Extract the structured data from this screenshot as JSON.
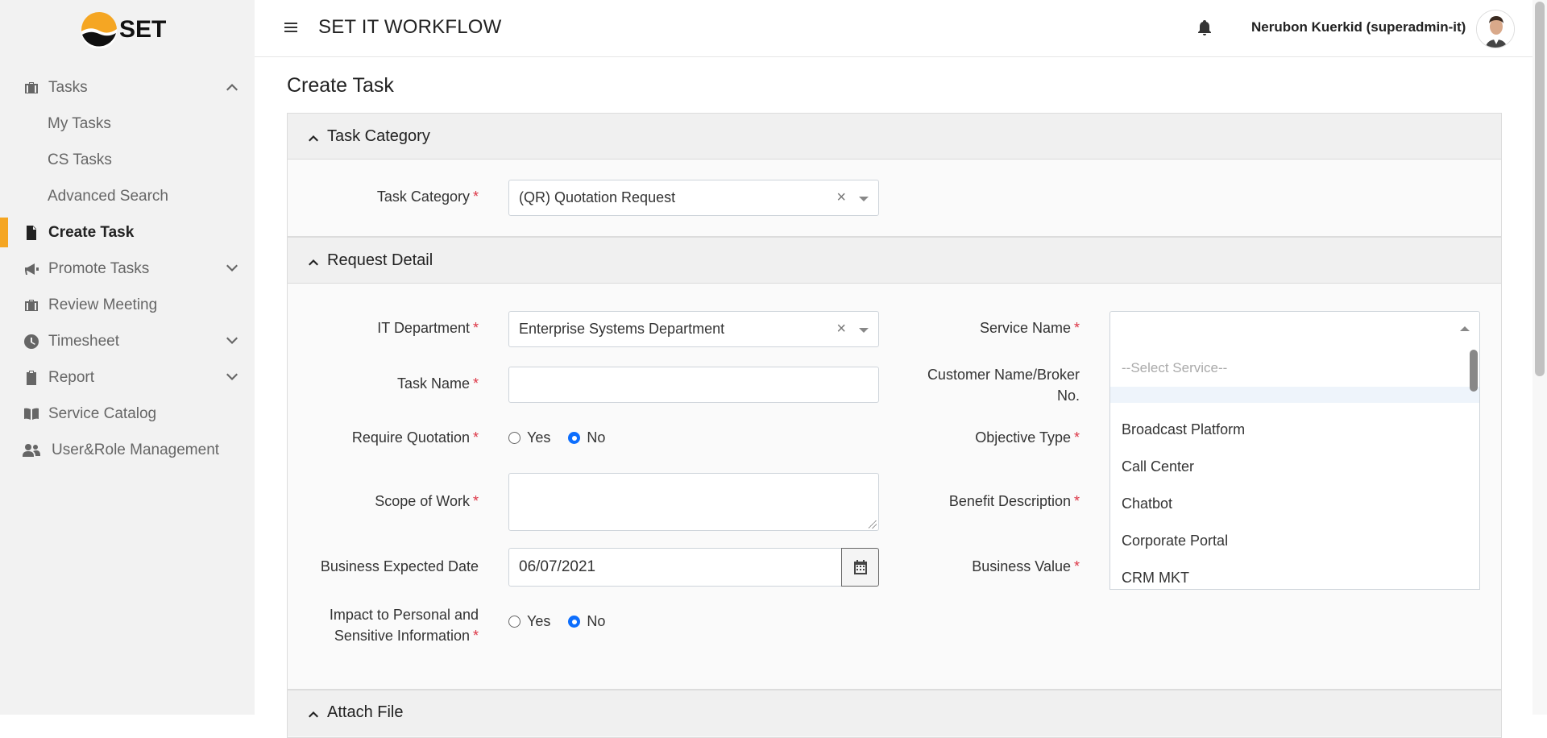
{
  "app": {
    "logo_text": "SET",
    "title": "SET IT WORKFLOW",
    "user": "Nerubon Kuerkid (superadmin-it)"
  },
  "sidebar": {
    "items": [
      {
        "label": "Tasks",
        "icon": "briefcase-icon"
      },
      {
        "label": "My Tasks"
      },
      {
        "label": "CS Tasks"
      },
      {
        "label": "Advanced Search"
      },
      {
        "label": "Create Task",
        "icon": "file-icon"
      },
      {
        "label": "Promote Tasks",
        "icon": "megaphone-icon"
      },
      {
        "label": "Review Meeting",
        "icon": "briefcase-icon"
      },
      {
        "label": "Timesheet",
        "icon": "clock-icon"
      },
      {
        "label": "Report",
        "icon": "clipboard-icon"
      },
      {
        "label": "Service Catalog",
        "icon": "book-icon"
      },
      {
        "label": "User&Role Management",
        "icon": "users-icon"
      }
    ],
    "accent_color": "#f5a623"
  },
  "page": {
    "title": "Create Task"
  },
  "task_category": {
    "header": "Task Category",
    "label": "Task Category",
    "value": "(QR) Quotation Request",
    "clear": "×"
  },
  "request_detail": {
    "header": "Request Detail",
    "it_department": {
      "label": "IT Department",
      "value": "Enterprise Systems Department",
      "clear": "×"
    },
    "task_name": {
      "label": "Task Name",
      "value": ""
    },
    "require_quotation": {
      "label": "Require Quotation",
      "options": [
        "Yes",
        "No"
      ],
      "selected": "No"
    },
    "scope_of_work": {
      "label": "Scope of Work",
      "value": ""
    },
    "business_expected_date": {
      "label": "Business Expected Date",
      "value": "06/07/2021"
    },
    "impact": {
      "label_line1": "Impact to Personal and",
      "label_line2": "Sensitive Information",
      "options": [
        "Yes",
        "No"
      ],
      "selected": "No"
    },
    "service_name": {
      "label": "Service Name",
      "value": ""
    },
    "customer_name": {
      "label_line1": "Customer Name/Broker",
      "label_line2": "No."
    },
    "objective_type": {
      "label": "Objective Type"
    },
    "benefit_description": {
      "label": "Benefit Description"
    },
    "business_value": {
      "label": "Business Value"
    },
    "required_marker": "*"
  },
  "service_dropdown": {
    "options": [
      "--Select Service--",
      "",
      "Broadcast Platform",
      "Call Center",
      "Chatbot",
      "Corporate Portal",
      "CRM MKT"
    ]
  },
  "attach_file": {
    "header": "Attach File"
  }
}
